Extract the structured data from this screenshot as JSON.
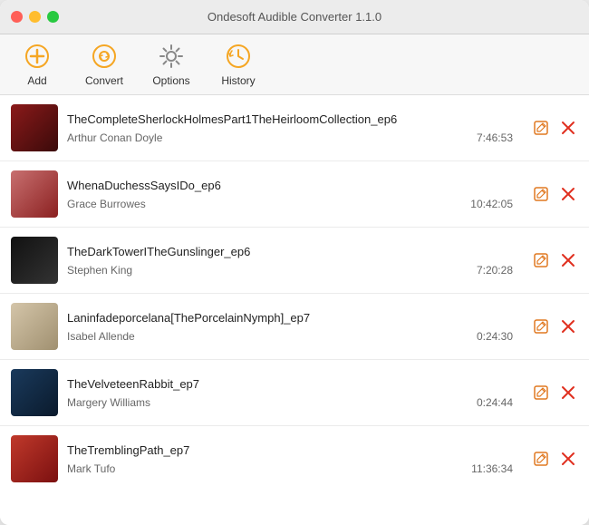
{
  "window": {
    "title": "Ondesoft Audible Converter 1.1.0"
  },
  "toolbar": {
    "add_label": "Add",
    "convert_label": "Convert",
    "options_label": "Options",
    "history_label": "History"
  },
  "tracks": [
    {
      "id": 1,
      "title": "TheCompleteSherlockHolmesPart1TheHeirloomCollection_ep6",
      "author": "Arthur Conan Doyle",
      "duration": "7:46:53",
      "cover_class": "cover-1"
    },
    {
      "id": 2,
      "title": "WhenaDuchessSaysIDo_ep6",
      "author": "Grace Burrowes",
      "duration": "10:42:05",
      "cover_class": "cover-2"
    },
    {
      "id": 3,
      "title": "TheDarkTowerITheGunslinger_ep6",
      "author": "Stephen King",
      "duration": "7:20:28",
      "cover_class": "cover-3"
    },
    {
      "id": 4,
      "title": "Laninfadeporcelana[ThePorcelainNymph]_ep7",
      "author": "Isabel Allende",
      "duration": "0:24:30",
      "cover_class": "cover-4"
    },
    {
      "id": 5,
      "title": "TheVelveteenRabbit_ep7",
      "author": "Margery Williams",
      "duration": "0:24:44",
      "cover_class": "cover-5"
    },
    {
      "id": 6,
      "title": "TheTremblingPath_ep7",
      "author": "Mark Tufo",
      "duration": "11:36:34",
      "cover_class": "cover-6"
    }
  ]
}
